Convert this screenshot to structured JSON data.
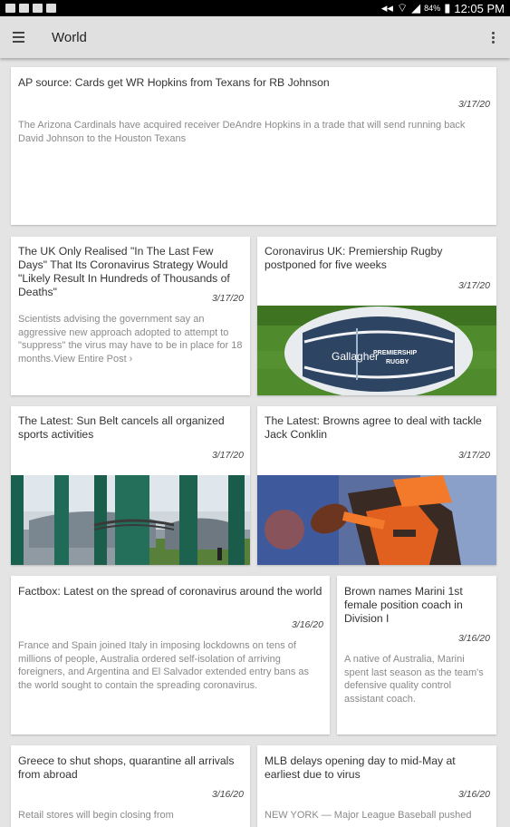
{
  "status_bar": {
    "battery": "84%",
    "time": "12:05 PM"
  },
  "app_bar": {
    "title": "World"
  },
  "articles": [
    {
      "title": "AP source: Cards get WR Hopkins from Texans for RB Johnson",
      "date": "3/17/20",
      "summary": "The Arizona Cardinals have acquired receiver DeAndre Hopkins in a trade that will send running back David Johnson to the Houston Texans"
    },
    {
      "title": "The UK Only Realised \"In The Last Few Days\" That Its Coronavirus Strategy Would \"Likely Result In Hundreds of Thousands of Deaths\"",
      "date": "3/17/20",
      "summary": "Scientists advising the government say an aggressive new approach adopted to attempt to \"suppress\" the virus may have to be in place for 18 months.View Entire Post ›"
    },
    {
      "title": "Coronavirus UK: Premiership Rugby postponed for five weeks",
      "date": "3/17/20",
      "image_text": [
        "Gallagher",
        "PREMIERSHIP",
        "RUGBY"
      ]
    },
    {
      "title": "The Latest: Sun Belt cancels all organized sports activities",
      "date": "3/17/20"
    },
    {
      "title": "The Latest: Browns agree to deal with tackle Jack Conklin",
      "date": "3/17/20"
    },
    {
      "title": "Factbox: Latest on the spread of coronavirus around the world",
      "date": "3/16/20",
      "summary": "France and Spain joined Italy in imposing lockdowns on tens of millions of people, Australia ordered self-isolation of arriving foreigners, and Argentina and El Salvador extended entry bans as the world sought to contain the spreading coronavirus."
    },
    {
      "title": "Brown names Marini 1st female position coach in Division I",
      "date": "3/16/20",
      "summary": "A native of Australia, Marini spent last season as the team's defensive quality control assistant coach."
    },
    {
      "title": "Greece to shut shops, quarantine all arrivals from abroad",
      "date": "3/16/20",
      "summary": "Retail stores will begin closing from"
    },
    {
      "title": "MLB delays opening day to mid-May at earliest due to virus",
      "date": "3/16/20",
      "summary": "NEW YORK — Major League Baseball pushed"
    }
  ]
}
